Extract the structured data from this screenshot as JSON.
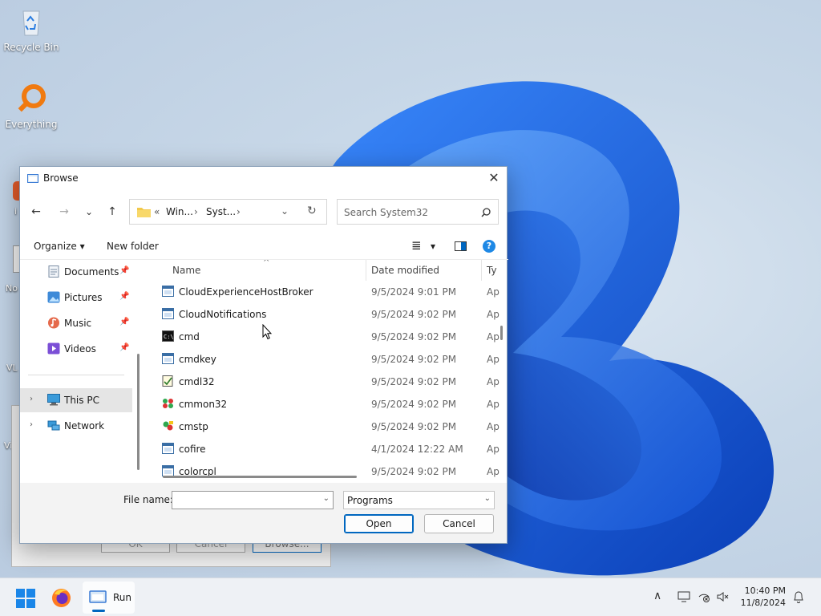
{
  "desktop": {
    "icons": [
      {
        "label": "Recycle Bin"
      },
      {
        "label": "Everything"
      }
    ],
    "partial_labels": [
      "i",
      "No",
      "VL",
      "Vi"
    ]
  },
  "run_dialog_behind": {
    "ok_label": "OK",
    "cancel_label": "Cancel",
    "browse_label": "Browse..."
  },
  "browse": {
    "title": "Browse",
    "close_glyph": "✕",
    "nav": {
      "back": "←",
      "forward": "→",
      "recent": "⌄",
      "up": "↑",
      "refresh": "↻",
      "breadcrumb_prefix": "«",
      "crumbs": [
        "Win...",
        "Syst..."
      ],
      "search_placeholder": "Search System32"
    },
    "toolbar": {
      "organize": "Organize ▾",
      "new_folder": "New folder",
      "view_glyph": "≣",
      "view_dropdown": "▾",
      "help_glyph": "?"
    },
    "sidebar": [
      {
        "label": "Documents",
        "icon": "documents-icon",
        "pinned": true
      },
      {
        "label": "Pictures",
        "icon": "pictures-icon",
        "pinned": true
      },
      {
        "label": "Music",
        "icon": "music-icon",
        "pinned": true
      },
      {
        "label": "Videos",
        "icon": "videos-icon",
        "pinned": true
      },
      {
        "label": "This PC",
        "icon": "pc-icon",
        "selected": true
      },
      {
        "label": "Network",
        "icon": "network-icon"
      }
    ],
    "columns": {
      "name": "Name",
      "date": "Date modified",
      "type": "Ty"
    },
    "files": [
      {
        "name": "CloudExperienceHostBroker",
        "date": "9/5/2024 9:01 PM",
        "type": "Ap",
        "icon": "app-window-icon"
      },
      {
        "name": "CloudNotifications",
        "date": "9/5/2024 9:02 PM",
        "type": "Ap",
        "icon": "app-window-icon"
      },
      {
        "name": "cmd",
        "date": "9/5/2024 9:02 PM",
        "type": "Ap",
        "icon": "console-icon"
      },
      {
        "name": "cmdkey",
        "date": "9/5/2024 9:02 PM",
        "type": "Ap",
        "icon": "app-window-icon"
      },
      {
        "name": "cmdl32",
        "date": "9/5/2024 9:02 PM",
        "type": "Ap",
        "icon": "cmdl32-icon"
      },
      {
        "name": "cmmon32",
        "date": "9/5/2024 9:02 PM",
        "type": "Ap",
        "icon": "cmmon-icon"
      },
      {
        "name": "cmstp",
        "date": "9/5/2024 9:02 PM",
        "type": "Ap",
        "icon": "cmstp-icon"
      },
      {
        "name": "cofire",
        "date": "4/1/2024 12:22 AM",
        "type": "Ap",
        "icon": "app-window-icon"
      },
      {
        "name": "colorcpl",
        "date": "9/5/2024 9:02 PM",
        "type": "Ap",
        "icon": "app-window-icon"
      }
    ],
    "filename_label": "File name:",
    "filename_value": "",
    "filetype_value": "Programs",
    "open_label": "Open",
    "cancel_label": "Cancel"
  },
  "taskbar": {
    "run_label": "Run",
    "time": "10:40 PM",
    "date": "11/8/2024",
    "chevron": "∧"
  }
}
